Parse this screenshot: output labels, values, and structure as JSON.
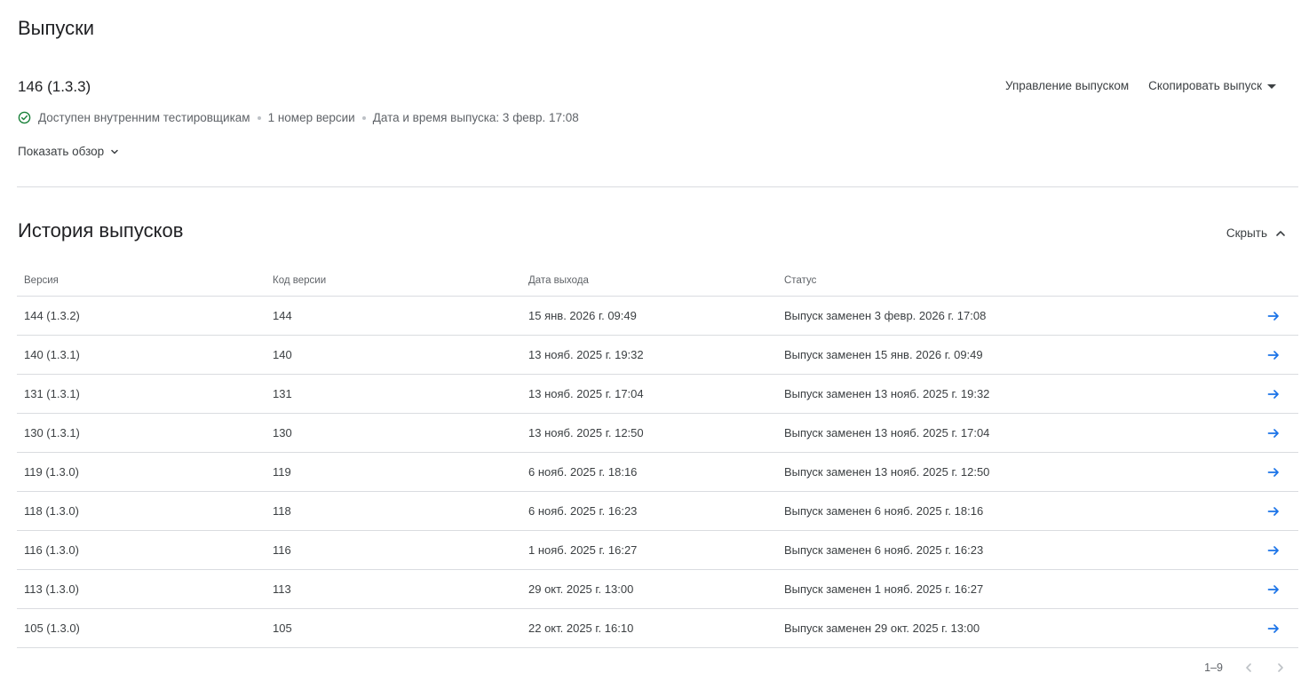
{
  "page": {
    "title": "Выпуски"
  },
  "current_release": {
    "name": "146 (1.3.3)",
    "manage_label": "Управление выпуском",
    "copy_label": "Скопировать выпуск",
    "status": "Доступен внутренним тестировщикам",
    "version_count": "1 номер версии",
    "release_datetime": "Дата и время выпуска: 3 февр. 17:08",
    "show_overview_label": "Показать обзор"
  },
  "history": {
    "title": "История выпусков",
    "hide_label": "Скрыть",
    "columns": [
      "Версия",
      "Код версии",
      "Дата выхода",
      "Статус"
    ],
    "rows": [
      {
        "version": "144 (1.3.2)",
        "code": "144",
        "date": "15 янв. 2026 г. 09:49",
        "status": "Выпуск заменен 3 февр. 2026 г. 17:08"
      },
      {
        "version": "140 (1.3.1)",
        "code": "140",
        "date": "13 нояб. 2025 г. 19:32",
        "status": "Выпуск заменен 15 янв. 2026 г. 09:49"
      },
      {
        "version": "131 (1.3.1)",
        "code": "131",
        "date": "13 нояб. 2025 г. 17:04",
        "status": "Выпуск заменен 13 нояб. 2025 г. 19:32"
      },
      {
        "version": "130 (1.3.1)",
        "code": "130",
        "date": "13 нояб. 2025 г. 12:50",
        "status": "Выпуск заменен 13 нояб. 2025 г. 17:04"
      },
      {
        "version": "119 (1.3.0)",
        "code": "119",
        "date": "6 нояб. 2025 г. 18:16",
        "status": "Выпуск заменен 13 нояб. 2025 г. 12:50"
      },
      {
        "version": "118 (1.3.0)",
        "code": "118",
        "date": "6 нояб. 2025 г. 16:23",
        "status": "Выпуск заменен 6 нояб. 2025 г. 18:16"
      },
      {
        "version": "116 (1.3.0)",
        "code": "116",
        "date": "1 нояб. 2025 г. 16:27",
        "status": "Выпуск заменен 6 нояб. 2025 г. 16:23"
      },
      {
        "version": "113 (1.3.0)",
        "code": "113",
        "date": "29 окт. 2025 г. 13:00",
        "status": "Выпуск заменен 1 нояб. 2025 г. 16:27"
      },
      {
        "version": "105 (1.3.0)",
        "code": "105",
        "date": "22 окт. 2025 г. 16:10",
        "status": "Выпуск заменен 29 окт. 2025 г. 13:00"
      }
    ],
    "pagination": "1–9"
  },
  "icons": {
    "status": "check-circle-icon",
    "row_action": "arrow-right-icon",
    "expand": "chevron-down-icon",
    "collapse": "chevron-up-icon",
    "prev": "chevron-left-icon",
    "next": "chevron-right-icon"
  },
  "colors": {
    "status_green": "#188038",
    "arrow_blue": "#1a73e8",
    "divider": "#dadce0"
  }
}
